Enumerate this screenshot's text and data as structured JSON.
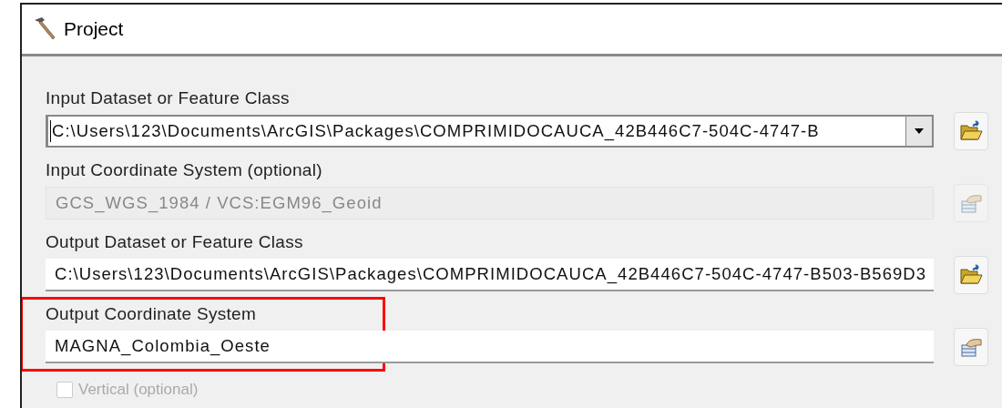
{
  "window": {
    "title": "Project"
  },
  "parameters": [
    {
      "label": "Input Dataset or Feature Class",
      "kind": "combo",
      "value": "C:\\Users\\123\\Documents\\ArcGIS\\Packages\\COMPRIMIDOCAUCA_42B446C7-504C-4747-B",
      "disabled": false,
      "highlighted": false,
      "button": {
        "kind": "folder"
      }
    },
    {
      "label": "Input Coordinate System (optional)",
      "kind": "text",
      "value": "GCS_WGS_1984 / VCS:EGM96_Geoid",
      "disabled": true,
      "highlighted": false,
      "button": {
        "kind": "properties"
      }
    },
    {
      "label": "Output Dataset or Feature Class",
      "kind": "text",
      "value": "C:\\Users\\123\\Documents\\ArcGIS\\Packages\\COMPRIMIDOCAUCA_42B446C7-504C-4747-B503-B569D3",
      "disabled": false,
      "highlighted": false,
      "button": {
        "kind": "folder"
      }
    },
    {
      "label": "Output Coordinate System",
      "kind": "text",
      "value": "MAGNA_Colombia_Oeste",
      "disabled": false,
      "highlighted": true,
      "button": {
        "kind": "properties"
      }
    }
  ],
  "vertical": {
    "label": "Vertical (optional)",
    "checked": false,
    "disabled": true
  }
}
